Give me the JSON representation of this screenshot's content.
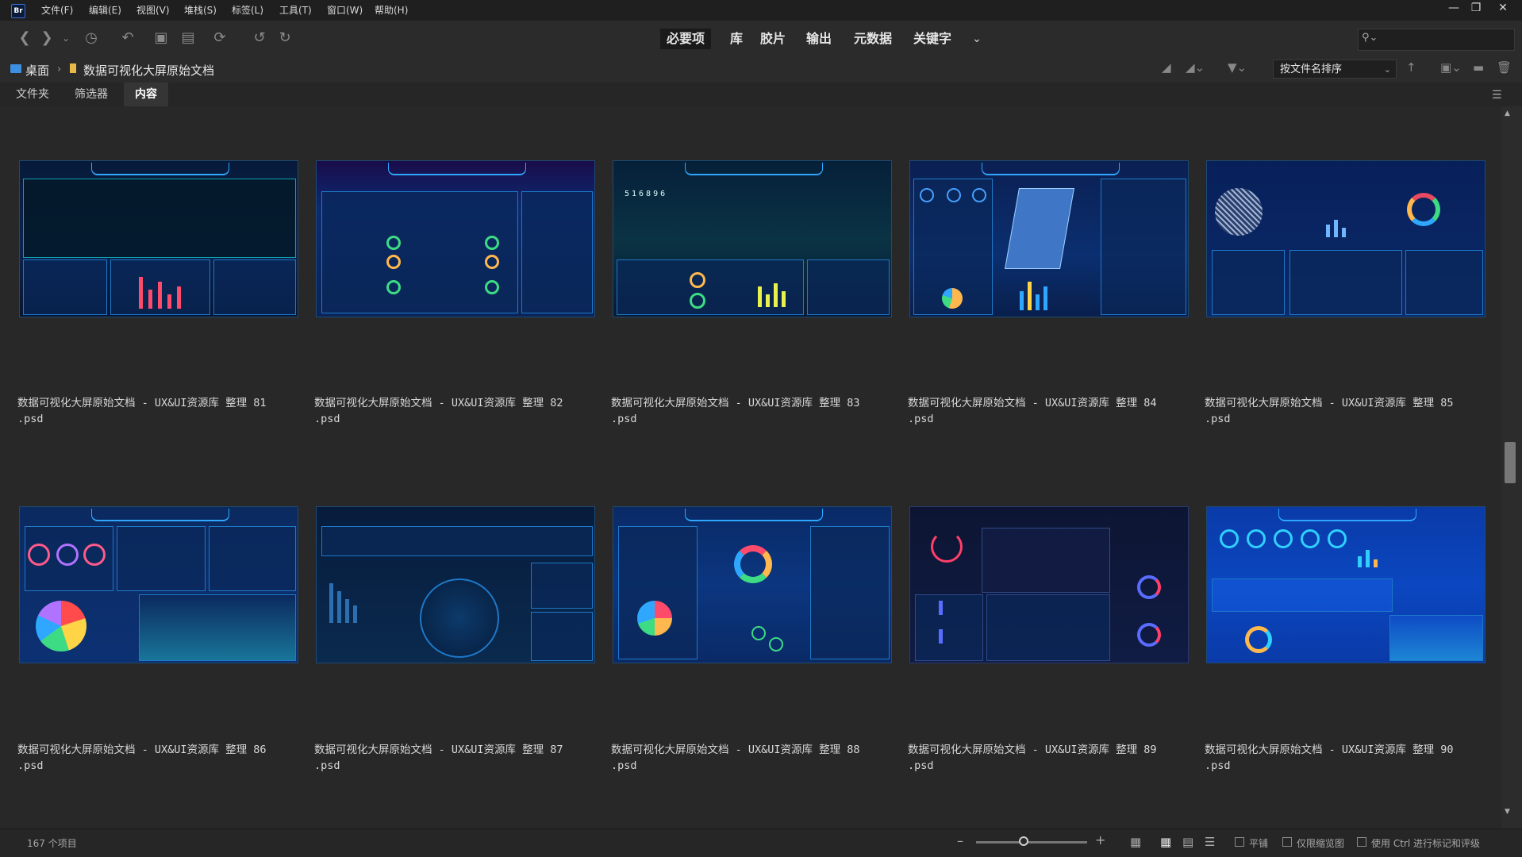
{
  "app": {
    "logo": "Br"
  },
  "menu": [
    "文件(F)",
    "编辑(E)",
    "视图(V)",
    "堆栈(S)",
    "标签(L)",
    "工具(T)",
    "窗口(W)",
    "帮助(H)"
  ],
  "workspaces": [
    "必要项",
    "库",
    "胶片",
    "输出",
    "元数据",
    "关键字"
  ],
  "workspace_active": "必要项",
  "search": {
    "placeholder": ""
  },
  "breadcrumb": [
    "桌面",
    "数据可视化大屏原始文档"
  ],
  "sort_label": "按文件名排序",
  "panel_tabs": [
    "文件夹",
    "筛选器",
    "内容"
  ],
  "items": [
    {
      "name_line1": "数据可视化大屏原始文档 - UX&UI资源库 整理 81",
      "name_line2": ".psd",
      "theme": "map"
    },
    {
      "name_line1": "数据可视化大屏原始文档 - UX&UI资源库 整理 82",
      "name_line2": ".psd",
      "theme": "table"
    },
    {
      "name_line1": "数据可视化大屏原始文档 - UX&UI资源库 整理 83",
      "name_line2": ".psd",
      "theme": "city",
      "digits": "516896"
    },
    {
      "name_line1": "数据可视化大屏原始文档 - UX&UI资源库 整理 84",
      "name_line2": ".psd",
      "theme": "campus"
    },
    {
      "name_line1": "数据可视化大屏原始文档 - UX&UI资源库 整理 85",
      "name_line2": ".psd",
      "theme": "globe"
    },
    {
      "name_line1": "数据可视化大屏原始文档 - UX&UI资源库 整理 86",
      "name_line2": ".psd",
      "theme": "pie"
    },
    {
      "name_line1": "数据可视化大屏原始文档 - UX&UI资源库 整理 87",
      "name_line2": ".psd",
      "theme": "world"
    },
    {
      "name_line1": "数据可视化大屏原始文档 - UX&UI资源库 整理 88",
      "name_line2": ".psd",
      "theme": "donut"
    },
    {
      "name_line1": "数据可视化大屏原始文档 - UX&UI资源库 整理 89",
      "name_line2": ".psd",
      "theme": "calendar"
    },
    {
      "name_line1": "数据可视化大屏原始文档 - UX&UI资源库 整理 90",
      "name_line2": ".psd",
      "theme": "school"
    }
  ],
  "status": {
    "count": "167 个项目",
    "opt_flat": "平铺",
    "opt_thumbs_only": "仅限缩览图",
    "opt_ctrl": "使用 Ctrl 进行标记和评级"
  },
  "zoom_level": 0.43,
  "colors": {
    "accent": "#2fa7ff",
    "background": "#282828",
    "bar": "#1f1f1f"
  }
}
